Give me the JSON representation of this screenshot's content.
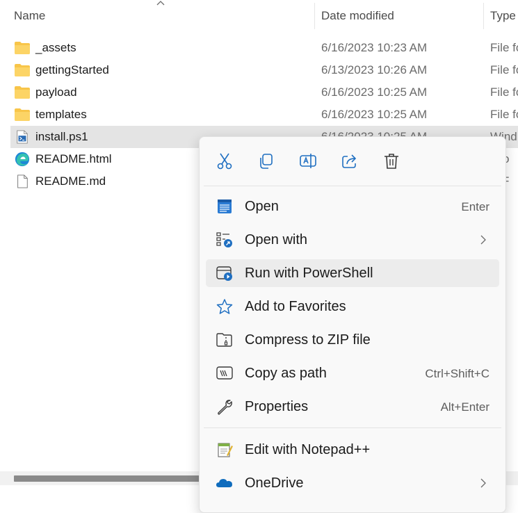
{
  "columns": {
    "name": "Name",
    "date_modified": "Date modified",
    "type": "Type"
  },
  "files": [
    {
      "name": "_assets",
      "date": "6/16/2023 10:23 AM",
      "type": "File fo",
      "icon": "folder-icon"
    },
    {
      "name": "gettingStarted",
      "date": "6/13/2023 10:26 AM",
      "type": "File fo",
      "icon": "folder-icon"
    },
    {
      "name": "payload",
      "date": "6/16/2023 10:25 AM",
      "type": "File fo",
      "icon": "folder-icon"
    },
    {
      "name": "templates",
      "date": "6/16/2023 10:25 AM",
      "type": "File fo",
      "icon": "folder-icon"
    },
    {
      "name": "install.ps1",
      "date": "6/16/2023 10:25 AM",
      "type": "Wind",
      "icon": "powershell-file-icon",
      "selected": true
    },
    {
      "name": "README.html",
      "date": "",
      "type": "icro",
      "icon": "edge-icon"
    },
    {
      "name": "README.md",
      "date": "",
      "type": "D F",
      "icon": "document-icon"
    }
  ],
  "context_menu": {
    "toolbar": [
      "cut-icon",
      "copy-icon",
      "rename-icon",
      "share-icon",
      "delete-icon"
    ],
    "items": [
      {
        "label": "Open",
        "shortcut": "Enter",
        "icon": "notepad-icon"
      },
      {
        "label": "Open with",
        "shortcut": "",
        "icon": "open-with-icon",
        "submenu": true
      },
      {
        "label": "Run with PowerShell",
        "shortcut": "",
        "icon": "powershell-run-icon",
        "hover": true
      },
      {
        "label": "Add to Favorites",
        "shortcut": "",
        "icon": "star-icon"
      },
      {
        "label": "Compress to ZIP file",
        "shortcut": "",
        "icon": "zip-folder-icon"
      },
      {
        "label": "Copy as path",
        "shortcut": "Ctrl+Shift+C",
        "icon": "copy-path-icon"
      },
      {
        "label": "Properties",
        "shortcut": "Alt+Enter",
        "icon": "wrench-icon"
      },
      {
        "label": "Edit with Notepad++",
        "shortcut": "",
        "icon": "notepadpp-icon"
      },
      {
        "label": "OneDrive",
        "shortcut": "",
        "icon": "onedrive-icon",
        "submenu": true
      }
    ]
  },
  "colors": {
    "accent": "#0f6cbd",
    "folder": "#f8c549",
    "selection": "#e4e4e4"
  }
}
